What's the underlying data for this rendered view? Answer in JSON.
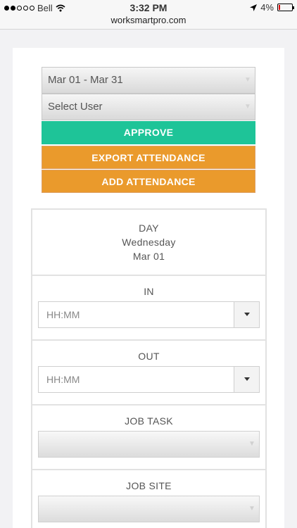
{
  "status_bar": {
    "carrier": "Bell",
    "time": "3:32 PM",
    "battery": "4%"
  },
  "browser": {
    "url": "worksmartpro.com"
  },
  "filters": {
    "date_range": "Mar 01 - Mar 31",
    "user_placeholder": "Select User"
  },
  "actions": {
    "approve": "APPROVE",
    "export": "EXPORT ATTENDANCE",
    "add": "ADD ATTENDANCE"
  },
  "entry": {
    "day_label": "DAY",
    "weekday": "Wednesday",
    "date": "Mar 01",
    "in_label": "IN",
    "in_placeholder": "HH:MM",
    "out_label": "OUT",
    "out_placeholder": "HH:MM",
    "job_task_label": "JOB TASK",
    "job_site_label": "JOB SITE"
  },
  "colors": {
    "approve": "#1ec498",
    "export": "#ea9a2c",
    "add": "#ea9a2c"
  }
}
